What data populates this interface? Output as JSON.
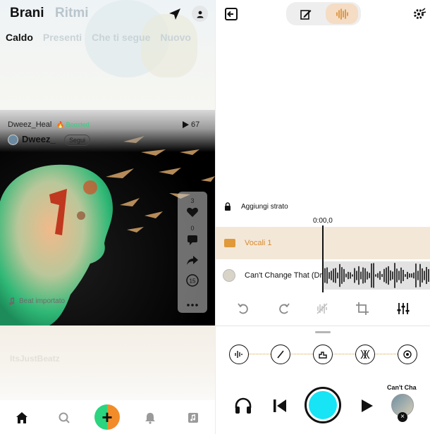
{
  "feed": {
    "title_active": "Brani",
    "title_inactive": "Ritmi",
    "tabs": [
      "Caldo",
      "Presenti",
      "Che ti segue",
      "Nuovo"
    ],
    "active_tab": "Caldo"
  },
  "post": {
    "username": "Dweez_Heal",
    "boosted_label": "Boosted",
    "play_count": "67",
    "display_name": "Dweez_",
    "follow_label": "Segui",
    "likes": "3",
    "comments": "0",
    "remix_count": "15",
    "beat_label": "Beat importato"
  },
  "next_post": {
    "artist_ghost": "ItsJustBeatz"
  },
  "bottom_nav": {
    "items": [
      "home-icon",
      "search-icon",
      "create-button",
      "bell-icon",
      "library-icon"
    ],
    "plus_label": "+"
  },
  "studio": {
    "add_layer_label": "Aggiungi strato",
    "timecode": "0:00,0",
    "tracks": [
      {
        "label": "Vocali 1"
      },
      {
        "label": "Can't Change That (Dr..."
      }
    ],
    "now_playing_title": "Can't Cha",
    "close_label": "×"
  },
  "colors": {
    "accent_orange": "#d98a2b",
    "record_cyan": "#17e4f4",
    "boost_green": "#2bd47e",
    "vocal_track_bg": "#f3e7d8"
  }
}
